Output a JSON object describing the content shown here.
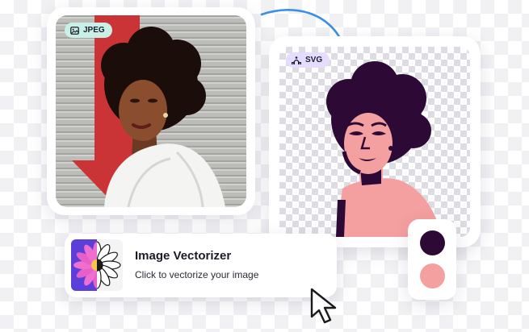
{
  "before": {
    "badge_label": "JPEG",
    "badge_icon": "image-icon",
    "badge_color": "#c9f0e6"
  },
  "after": {
    "badge_label": "SVG",
    "badge_icon": "vector-path-icon",
    "badge_color": "#e5dcff"
  },
  "conversion_arrow": {
    "icon": "curved-arrow-icon",
    "color": "#3d8ee6"
  },
  "palette": {
    "colors": [
      "#2d0a36",
      "#f5a0a0"
    ]
  },
  "tool": {
    "title": "Image Vectorizer",
    "subtitle": "Click to vectorize your image",
    "thumbnail_icon": "flower-icon"
  },
  "cursor": {
    "icon": "mouse-pointer-icon"
  }
}
